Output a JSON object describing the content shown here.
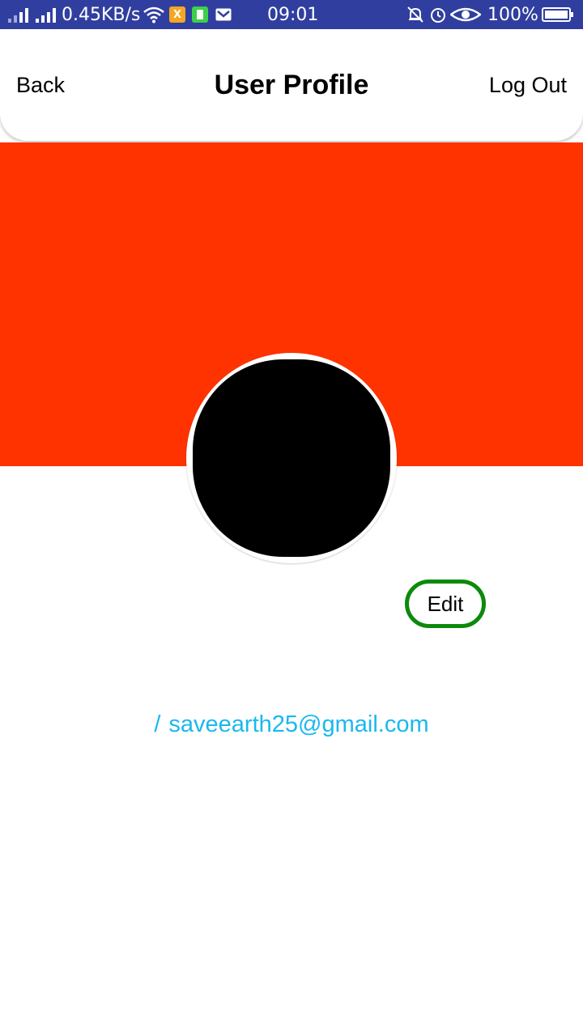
{
  "status_bar": {
    "network_speed": "0.45KB/s",
    "time": "09:01",
    "battery_percent": "100%",
    "icons": [
      "signal-icon",
      "signal-icon",
      "wifi-icon",
      "app-notification-icon",
      "battery-app-icon",
      "gmail-icon",
      "bell-muted-icon",
      "alarm-icon",
      "eye-icon",
      "battery-icon"
    ]
  },
  "header": {
    "back_label": "Back",
    "title": "User Profile",
    "logout_label": "Log Out"
  },
  "banner": {
    "color": "#ff3300"
  },
  "profile": {
    "edit_label": "Edit",
    "email_prefix": "/",
    "email": "saveearth25@gmail.com"
  },
  "colors": {
    "status_bar": "#303f9f",
    "edit_border": "#0b8a0b",
    "email_text": "#1ab8ef"
  }
}
